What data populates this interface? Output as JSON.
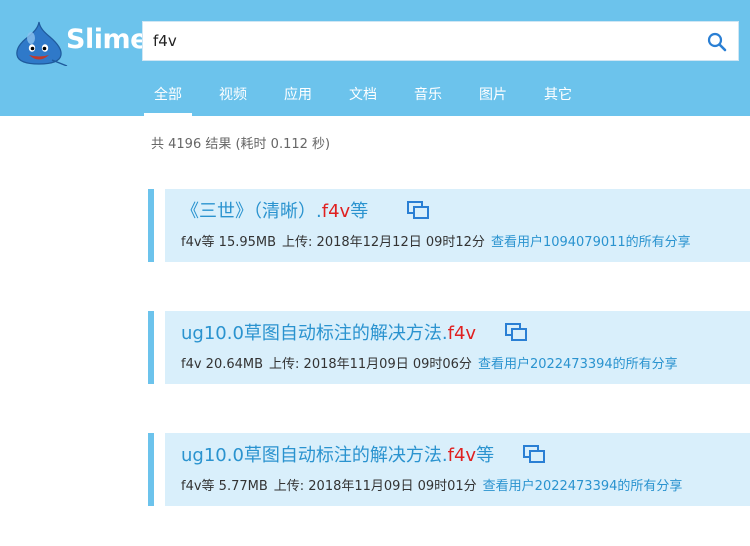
{
  "brand": {
    "name": "Slime"
  },
  "search": {
    "value": "f4v"
  },
  "tabs": [
    {
      "label": "全部",
      "active": true
    },
    {
      "label": "视频"
    },
    {
      "label": "应用"
    },
    {
      "label": "文档"
    },
    {
      "label": "音乐"
    },
    {
      "label": "图片"
    },
    {
      "label": "其它"
    }
  ],
  "stats": {
    "text": "共 4196 结果 (耗时 0.112 秒)"
  },
  "results": [
    {
      "title_prefix": "《三世》（清晰）.",
      "title_highlight": "f4v",
      "title_suffix": "等",
      "size": "f4v等 15.95MB",
      "upload": "上传: 2018年12月12日 09时12分",
      "user_link": "查看用户1094079011的所有分享"
    },
    {
      "title_prefix": "ug10.0草图自动标注的解决方法.",
      "title_highlight": "f4v",
      "title_suffix": "",
      "size": "f4v 20.64MB",
      "upload": "上传: 2018年11月09日 09时06分",
      "user_link": "查看用户2022473394的所有分享"
    },
    {
      "title_prefix": "ug10.0草图自动标注的解决方法.",
      "title_highlight": "f4v",
      "title_suffix": "等",
      "size": "f4v等 5.77MB",
      "upload": "上传: 2018年11月09日 09时01分",
      "user_link": "查看用户2022473394的所有分享"
    }
  ],
  "colors": {
    "header": "#6cc3ec",
    "link": "#2a93cf",
    "highlight": "#e02020",
    "card": "#d9effb"
  },
  "icons": {
    "logo": "slime-mascot-icon",
    "search": "search-icon",
    "open": "open-window-icon"
  }
}
